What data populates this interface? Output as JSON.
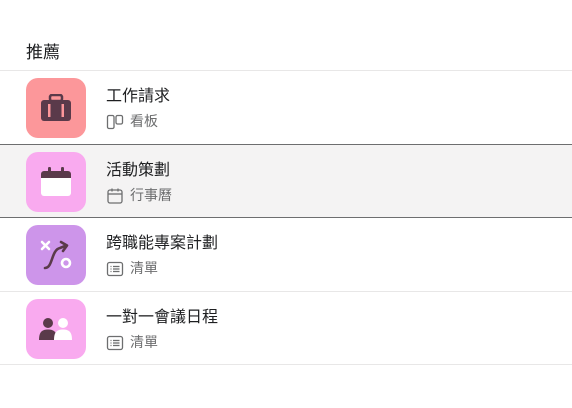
{
  "section": {
    "title": "推薦"
  },
  "templates": [
    {
      "name": "工作請求",
      "view": "看板",
      "view_icon": "board-icon",
      "tile_icon": "briefcase-icon",
      "tile_color": "#fc979a",
      "selected": false
    },
    {
      "name": "活動策劃",
      "view": "行事曆",
      "view_icon": "calendar-icon",
      "tile_icon": "calendar-icon",
      "tile_color": "#f9aaef",
      "selected": true
    },
    {
      "name": "跨職能專案計劃",
      "view": "清單",
      "view_icon": "list-icon",
      "tile_icon": "path-icon",
      "tile_color": "#cd95ea",
      "selected": false
    },
    {
      "name": "一對一會議日程",
      "view": "清單",
      "view_icon": "list-icon",
      "tile_icon": "people-icon",
      "tile_color": "#f9aaef",
      "selected": false
    }
  ],
  "colors": {
    "icon_dark": "#5a3a4a",
    "meta_gray": "#6d6e6f",
    "divider": "#e8e7e7",
    "selected_bg": "#f4f3f3"
  }
}
